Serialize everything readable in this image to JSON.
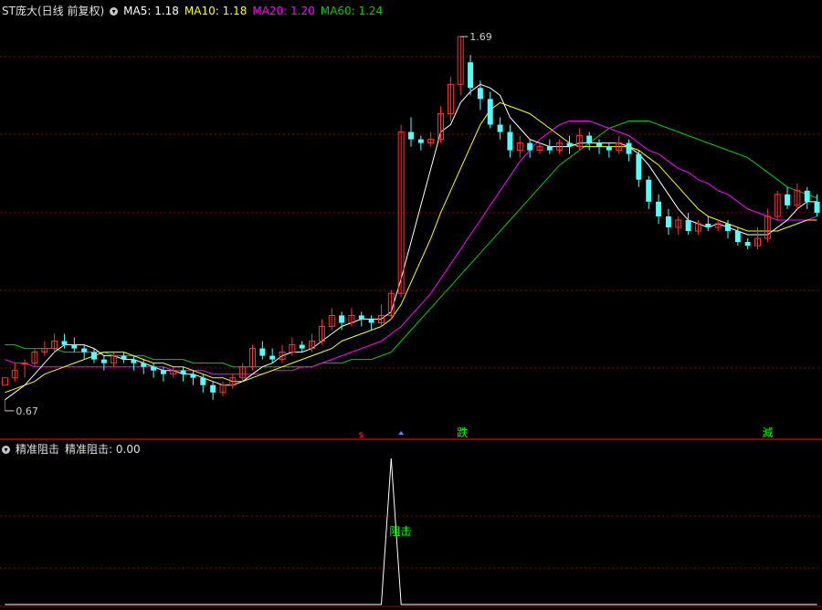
{
  "header": {
    "stock_title": "ST庞大(日线 前复权)",
    "ma5": "MA5: 1.18",
    "ma10": "MA10: 1.18",
    "ma20": "MA20: 1.20",
    "ma60": "MA60: 1.24"
  },
  "indicator_header": {
    "name": "精准阻击",
    "value": "精准阻击: 0.00"
  },
  "annotations": {
    "high_label": "1.69",
    "low_label": "0.67",
    "signal_die": "跌",
    "signal_jian": "減",
    "zuji_label": "阻击"
  },
  "colors": {
    "background": "#000000",
    "grid": "#8b0000",
    "up_candle": "#ff3232",
    "down_candle": "#54fcfc",
    "ma5": "#ffffff",
    "ma10": "#ffff00",
    "ma20": "#ff00ff",
    "ma60": "#00cc00",
    "signal_green": "#00ff00",
    "signal_red": "#ff3232",
    "indicator_line": "#ffffff"
  },
  "chart_data": {
    "type": "candlestick",
    "price_range": [
      0.6,
      1.74
    ],
    "high": 1.69,
    "low": 0.67,
    "candles": [
      [
        0.74,
        0.76,
        0.7,
        0.67
      ],
      [
        0.76,
        0.78,
        0.8,
        0.75
      ],
      [
        0.8,
        0.8,
        0.81,
        0.76
      ],
      [
        0.8,
        0.83,
        0.84,
        0.79
      ],
      [
        0.83,
        0.84,
        0.86,
        0.82
      ],
      [
        0.84,
        0.86,
        0.88,
        0.83
      ],
      [
        0.86,
        0.85,
        0.88,
        0.84
      ],
      [
        0.85,
        0.84,
        0.87,
        0.83
      ],
      [
        0.84,
        0.83,
        0.85,
        0.81
      ],
      [
        0.83,
        0.81,
        0.84,
        0.8
      ],
      [
        0.81,
        0.8,
        0.82,
        0.78
      ],
      [
        0.8,
        0.82,
        0.83,
        0.79
      ],
      [
        0.82,
        0.81,
        0.83,
        0.8
      ],
      [
        0.81,
        0.8,
        0.82,
        0.78
      ],
      [
        0.8,
        0.79,
        0.81,
        0.77
      ],
      [
        0.79,
        0.78,
        0.8,
        0.76
      ],
      [
        0.78,
        0.77,
        0.79,
        0.75
      ],
      [
        0.77,
        0.78,
        0.79,
        0.76
      ],
      [
        0.78,
        0.77,
        0.79,
        0.75
      ],
      [
        0.77,
        0.76,
        0.78,
        0.74
      ],
      [
        0.76,
        0.74,
        0.77,
        0.72
      ],
      [
        0.74,
        0.72,
        0.75,
        0.7
      ],
      [
        0.72,
        0.74,
        0.75,
        0.71
      ],
      [
        0.74,
        0.76,
        0.77,
        0.73
      ],
      [
        0.76,
        0.79,
        0.8,
        0.75
      ],
      [
        0.79,
        0.84,
        0.85,
        0.78
      ],
      [
        0.84,
        0.82,
        0.86,
        0.81
      ],
      [
        0.82,
        0.81,
        0.84,
        0.8
      ],
      [
        0.81,
        0.83,
        0.85,
        0.8
      ],
      [
        0.83,
        0.85,
        0.87,
        0.82
      ],
      [
        0.85,
        0.84,
        0.86,
        0.83
      ],
      [
        0.84,
        0.86,
        0.88,
        0.83
      ],
      [
        0.86,
        0.9,
        0.92,
        0.85
      ],
      [
        0.9,
        0.93,
        0.95,
        0.89
      ],
      [
        0.93,
        0.91,
        0.94,
        0.89
      ],
      [
        0.91,
        0.93,
        0.95,
        0.9
      ],
      [
        0.93,
        0.92,
        0.94,
        0.9
      ],
      [
        0.92,
        0.91,
        0.93,
        0.89
      ],
      [
        0.91,
        0.93,
        0.96,
        0.9
      ],
      [
        0.93,
        0.99,
        1.0,
        0.92
      ],
      [
        0.99,
        1.43,
        1.45,
        0.98
      ],
      [
        1.43,
        1.41,
        1.47,
        1.39
      ],
      [
        1.41,
        1.4,
        1.42,
        1.38
      ],
      [
        1.4,
        1.41,
        1.43,
        1.39
      ],
      [
        1.41,
        1.48,
        1.5,
        1.4
      ],
      [
        1.48,
        1.56,
        1.58,
        1.46
      ],
      [
        1.56,
        1.69,
        1.69,
        1.53
      ],
      [
        1.62,
        1.55,
        1.64,
        1.53
      ],
      [
        1.55,
        1.52,
        1.57,
        1.49
      ],
      [
        1.52,
        1.45,
        1.54,
        1.44
      ],
      [
        1.45,
        1.43,
        1.47,
        1.41
      ],
      [
        1.43,
        1.38,
        1.45,
        1.36
      ],
      [
        1.38,
        1.4,
        1.42,
        1.36
      ],
      [
        1.4,
        1.38,
        1.41,
        1.36
      ],
      [
        1.38,
        1.39,
        1.4,
        1.37
      ],
      [
        1.39,
        1.38,
        1.41,
        1.37
      ],
      [
        1.38,
        1.4,
        1.41,
        1.37
      ],
      [
        1.4,
        1.39,
        1.42,
        1.37
      ],
      [
        1.39,
        1.42,
        1.44,
        1.38
      ],
      [
        1.42,
        1.4,
        1.43,
        1.38
      ],
      [
        1.4,
        1.39,
        1.41,
        1.37
      ],
      [
        1.39,
        1.38,
        1.4,
        1.36
      ],
      [
        1.38,
        1.4,
        1.42,
        1.37
      ],
      [
        1.4,
        1.37,
        1.41,
        1.35
      ],
      [
        1.37,
        1.3,
        1.38,
        1.28
      ],
      [
        1.3,
        1.24,
        1.31,
        1.22
      ],
      [
        1.24,
        1.2,
        1.26,
        1.18
      ],
      [
        1.2,
        1.17,
        1.22,
        1.15
      ],
      [
        1.17,
        1.19,
        1.2,
        1.15
      ],
      [
        1.19,
        1.16,
        1.21,
        1.15
      ],
      [
        1.16,
        1.18,
        1.19,
        1.15
      ],
      [
        1.18,
        1.17,
        1.2,
        1.16
      ],
      [
        1.17,
        1.18,
        1.19,
        1.16
      ],
      [
        1.18,
        1.16,
        1.19,
        1.14
      ],
      [
        1.16,
        1.13,
        1.17,
        1.12
      ],
      [
        1.13,
        1.12,
        1.14,
        1.11
      ],
      [
        1.12,
        1.14,
        1.17,
        1.11
      ],
      [
        1.14,
        1.2,
        1.22,
        1.13
      ],
      [
        1.2,
        1.26,
        1.27,
        1.19
      ],
      [
        1.26,
        1.23,
        1.28,
        1.22
      ],
      [
        1.23,
        1.27,
        1.29,
        1.22
      ],
      [
        1.27,
        1.24,
        1.28,
        1.22
      ],
      [
        1.24,
        1.21,
        1.26,
        1.2
      ]
    ],
    "ma5": [
      0.7,
      0.72,
      0.74,
      0.77,
      0.8,
      0.83,
      0.85,
      0.85,
      0.85,
      0.84,
      0.82,
      0.82,
      0.81,
      0.81,
      0.8,
      0.79,
      0.78,
      0.78,
      0.77,
      0.77,
      0.76,
      0.75,
      0.74,
      0.74,
      0.75,
      0.77,
      0.79,
      0.8,
      0.82,
      0.83,
      0.83,
      0.84,
      0.86,
      0.88,
      0.9,
      0.91,
      0.92,
      0.92,
      0.92,
      0.94,
      1.03,
      1.13,
      1.23,
      1.33,
      1.43,
      1.45,
      1.51,
      1.54,
      1.56,
      1.55,
      1.53,
      1.47,
      1.44,
      1.41,
      1.4,
      1.39,
      1.39,
      1.39,
      1.4,
      1.4,
      1.4,
      1.4,
      1.4,
      1.39,
      1.37,
      1.34,
      1.3,
      1.26,
      1.22,
      1.19,
      1.18,
      1.17,
      1.18,
      1.17,
      1.16,
      1.15,
      1.15,
      1.15,
      1.17,
      1.19,
      1.22,
      1.24,
      1.24
    ],
    "ma10": [
      0.72,
      0.73,
      0.74,
      0.75,
      0.77,
      0.78,
      0.79,
      0.8,
      0.81,
      0.82,
      0.83,
      0.83,
      0.83,
      0.82,
      0.81,
      0.8,
      0.8,
      0.79,
      0.79,
      0.78,
      0.77,
      0.76,
      0.76,
      0.75,
      0.75,
      0.76,
      0.77,
      0.78,
      0.79,
      0.8,
      0.81,
      0.82,
      0.83,
      0.84,
      0.86,
      0.87,
      0.88,
      0.89,
      0.9,
      0.92,
      0.96,
      1.02,
      1.08,
      1.14,
      1.21,
      1.27,
      1.33,
      1.39,
      1.45,
      1.49,
      1.51,
      1.5,
      1.49,
      1.48,
      1.46,
      1.44,
      1.42,
      1.4,
      1.39,
      1.39,
      1.39,
      1.39,
      1.39,
      1.39,
      1.38,
      1.36,
      1.34,
      1.31,
      1.28,
      1.25,
      1.22,
      1.2,
      1.19,
      1.18,
      1.17,
      1.16,
      1.16,
      1.16,
      1.16,
      1.17,
      1.18,
      1.19,
      1.19
    ],
    "ma20": [
      0.81,
      0.8,
      0.8,
      0.79,
      0.79,
      0.79,
      0.79,
      0.79,
      0.79,
      0.79,
      0.79,
      0.79,
      0.79,
      0.79,
      0.79,
      0.79,
      0.79,
      0.78,
      0.78,
      0.78,
      0.78,
      0.77,
      0.77,
      0.77,
      0.77,
      0.77,
      0.77,
      0.78,
      0.78,
      0.78,
      0.79,
      0.79,
      0.8,
      0.81,
      0.82,
      0.83,
      0.84,
      0.85,
      0.86,
      0.88,
      0.9,
      0.93,
      0.96,
      0.99,
      1.03,
      1.07,
      1.11,
      1.15,
      1.19,
      1.23,
      1.27,
      1.31,
      1.35,
      1.38,
      1.41,
      1.43,
      1.45,
      1.46,
      1.46,
      1.46,
      1.45,
      1.44,
      1.43,
      1.42,
      1.4,
      1.38,
      1.37,
      1.35,
      1.33,
      1.32,
      1.3,
      1.29,
      1.27,
      1.26,
      1.24,
      1.22,
      1.21,
      1.2,
      1.19,
      1.19,
      1.19,
      1.19,
      1.2
    ],
    "ma60": [
      0.85,
      0.85,
      0.84,
      0.84,
      0.84,
      0.84,
      0.83,
      0.83,
      0.83,
      0.83,
      0.83,
      0.82,
      0.82,
      0.82,
      0.82,
      0.81,
      0.81,
      0.81,
      0.81,
      0.8,
      0.8,
      0.8,
      0.8,
      0.79,
      0.79,
      0.79,
      0.79,
      0.79,
      0.79,
      0.79,
      0.79,
      0.79,
      0.8,
      0.8,
      0.8,
      0.81,
      0.81,
      0.81,
      0.82,
      0.83,
      0.86,
      0.89,
      0.92,
      0.95,
      0.98,
      1.01,
      1.04,
      1.07,
      1.1,
      1.13,
      1.16,
      1.19,
      1.22,
      1.25,
      1.28,
      1.31,
      1.34,
      1.36,
      1.38,
      1.4,
      1.42,
      1.44,
      1.45,
      1.46,
      1.46,
      1.46,
      1.45,
      1.44,
      1.43,
      1.42,
      1.41,
      1.4,
      1.39,
      1.38,
      1.37,
      1.36,
      1.34,
      1.32,
      1.3,
      1.28,
      1.27,
      1.26,
      1.25
    ],
    "indicator": {
      "name": "精准阻击",
      "value": 0.0,
      "spike_index": 39,
      "spike_value": 1
    }
  }
}
